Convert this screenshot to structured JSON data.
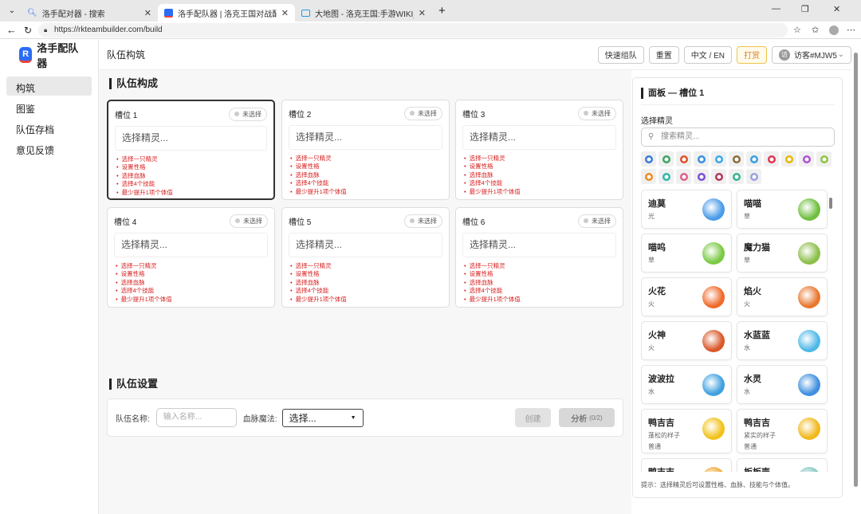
{
  "browser": {
    "tabs": [
      {
        "title": "洛手配对器 - 搜索",
        "icon": "search-icon"
      },
      {
        "title": "洛手配队器 | 洛克王国对战配队工具",
        "icon": "app-icon"
      },
      {
        "title": "大地图 - 洛克王国:手游WIKI_BWIKI",
        "icon": "bilibili-icon"
      }
    ],
    "url": "https://rkteambuilder.com/build"
  },
  "app": {
    "logo_letter": "R",
    "name": "洛手配队器",
    "nav": [
      "构筑",
      "图鉴",
      "队伍存档",
      "意见反馈"
    ],
    "page_title": "队伍构筑",
    "header_buttons": {
      "quick": "快速组队",
      "reset": "重置",
      "lang": "中文 / EN",
      "tip": "打赏",
      "user_avatar": "访",
      "user": "访客#MJW5"
    }
  },
  "team": {
    "title": "队伍构成",
    "slots": [
      {
        "label": "槽位 1"
      },
      {
        "label": "槽位 2"
      },
      {
        "label": "槽位 3"
      },
      {
        "label": "槽位 4"
      },
      {
        "label": "槽位 5"
      },
      {
        "label": "槽位 6"
      }
    ],
    "status": "未选择",
    "placeholder": "选择精灵...",
    "requirements": [
      "选择一只精灵",
      "设置性格",
      "选择血脉",
      "选择4个技能",
      "最少提升1项个体值"
    ]
  },
  "settings": {
    "title": "队伍设置",
    "name_label": "队伍名称:",
    "name_placeholder": "输入名称...",
    "magic_label": "血脉魔法:",
    "magic_value": "选择...",
    "create": "创建",
    "analyze": "分析",
    "analyze_count": "(0/2)"
  },
  "panel": {
    "title": "面板 — 槽位 1",
    "select_label": "选择精灵",
    "search_placeholder": "搜索精灵...",
    "type_colors": [
      "#3a7bd5",
      "#3da35d",
      "#e0522b",
      "#3b8fe0",
      "#38a9e8",
      "#8a6d3b",
      "#3b9ee0",
      "#e0364f",
      "#e6b800",
      "#b34fd8",
      "#8cc63f",
      "#f08a24",
      "#2fb5a8",
      "#e0608a",
      "#7a4fd8",
      "#b03a5b",
      "#36b58e",
      "#9aa0e0"
    ],
    "pets": [
      {
        "name": "迪莫",
        "type": "光",
        "color": "#4a9be8"
      },
      {
        "name": "喵喵",
        "type": "草",
        "color": "#6fbf3f"
      },
      {
        "name": "喵呜",
        "type": "草",
        "color": "#7ac943"
      },
      {
        "name": "魔力猫",
        "type": "草",
        "color": "#8cbf4a"
      },
      {
        "name": "火花",
        "type": "火",
        "color": "#f06a2a"
      },
      {
        "name": "焰火",
        "type": "火",
        "color": "#e8772e"
      },
      {
        "name": "火神",
        "type": "火",
        "color": "#d9582a"
      },
      {
        "name": "水蓝蓝",
        "type": "水",
        "color": "#4fb8e8"
      },
      {
        "name": "波波拉",
        "type": "水",
        "color": "#3fa0e0"
      },
      {
        "name": "水灵",
        "type": "水",
        "color": "#3f8fe0"
      },
      {
        "name": "鸭吉吉",
        "form": "蓬松的样子",
        "type": "普通",
        "color": "#f2c21b"
      },
      {
        "name": "鸭吉吉",
        "form": "紧实的样子",
        "type": "普通",
        "color": "#f2b81b"
      },
      {
        "name": "鸭吉吉",
        "type": "",
        "color": "#f0a830"
      },
      {
        "name": "板板壳",
        "type": "",
        "color": "#7fc6c0"
      }
    ],
    "hint": "提示：选择精灵后可设置性格、血脉、技能与个体值。"
  }
}
